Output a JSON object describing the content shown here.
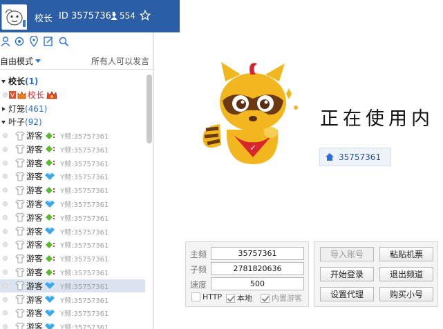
{
  "header": {
    "name": "校长",
    "id_text": "ID 35757361",
    "count": "554",
    "icons": [
      "avatar",
      "person-icon",
      "star-icon",
      "plane-icon",
      "share-icon"
    ]
  },
  "toolbar": {
    "icons": [
      "contacts-icon",
      "refresh-icon",
      "location-icon",
      "edit-icon",
      "search-icon"
    ]
  },
  "mode": {
    "selected": "自由模式",
    "note": "所有人可以发言"
  },
  "tree": {
    "groups": [
      {
        "label": "校长",
        "count": "(1)",
        "expanded": true
      },
      {
        "label": "灯笼",
        "count": "(461)",
        "expanded": false
      },
      {
        "label": "叶子",
        "count": "(92)",
        "expanded": true
      }
    ],
    "leader": {
      "name": "校长",
      "badge": "V"
    },
    "users": [
      {
        "name": "游客",
        "badge": "green",
        "info": "Y频:35757361"
      },
      {
        "name": "游客",
        "badge": "green",
        "info": "Y频:35757361"
      },
      {
        "name": "游客",
        "badge": "green",
        "info": "Y频:35757361"
      },
      {
        "name": "游客",
        "badge": "blue",
        "info": "Y频:35757361"
      },
      {
        "name": "游客",
        "badge": "green",
        "info": "Y频:35757361"
      },
      {
        "name": "游客",
        "badge": "blue",
        "info": "Y频:35757361"
      },
      {
        "name": "游客",
        "badge": "green",
        "info": "Y频:35757361"
      },
      {
        "name": "游客",
        "badge": "blue",
        "info": "Y频:35757361"
      },
      {
        "name": "游客",
        "badge": "green",
        "info": "Y频:35757361"
      },
      {
        "name": "游客",
        "badge": "green",
        "info": "Y频:35757361"
      },
      {
        "name": "游客",
        "badge": "green",
        "info": "Y频:35757361"
      },
      {
        "name": "游客",
        "badge": "blue",
        "info": "Y频:35757361",
        "selected": true
      },
      {
        "name": "游客",
        "badge": "blue",
        "info": "Y频:35757361"
      },
      {
        "name": "游客",
        "badge": "blue",
        "info": "Y频:35757361"
      },
      {
        "name": "游客",
        "badge": "blue",
        "info": "Y频:35757361"
      }
    ]
  },
  "main": {
    "status_text": "正在使用内",
    "room_id": "35757361"
  },
  "form": {
    "main_label": "主频",
    "main_value": "35757361",
    "sub_label": "子频",
    "sub_value": "2781820636",
    "speed_label": "速度",
    "speed_value": "500",
    "http_label": "HTTP",
    "local_label": "本地",
    "builtin_label": "内置游客"
  },
  "buttons": {
    "import_label": "导入账号",
    "paste_label": "粘贴机票",
    "start_label": "开始登录",
    "exit_label": "退出频道",
    "proxy_label": "设置代理",
    "buy_label": "购买小号"
  },
  "colors": {
    "header_bg": "#2c5ea8",
    "accent_blue": "#2b6ed6",
    "badge_green": "#5cb82c",
    "badge_blue": "#39a8e6",
    "mascot_yellow": "#f2b61f",
    "mascot_red": "#d9252b"
  }
}
